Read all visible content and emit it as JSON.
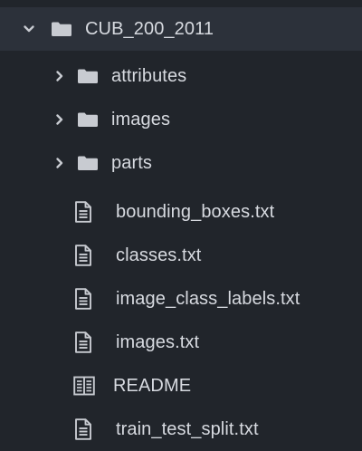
{
  "file_tree": {
    "root": {
      "label": "CUB_200_2011",
      "expanded": true,
      "icon": "folder-icon"
    },
    "folders": [
      {
        "label": "attributes",
        "expanded": false,
        "icon": "folder-icon"
      },
      {
        "label": "images",
        "expanded": false,
        "icon": "folder-icon"
      },
      {
        "label": "parts",
        "expanded": false,
        "icon": "folder-icon"
      }
    ],
    "files": [
      {
        "label": "bounding_boxes.txt",
        "icon": "text-file-icon"
      },
      {
        "label": "classes.txt",
        "icon": "text-file-icon"
      },
      {
        "label": "image_class_labels.txt",
        "icon": "text-file-icon"
      },
      {
        "label": "images.txt",
        "icon": "text-file-icon"
      },
      {
        "label": "README",
        "icon": "book-file-icon"
      },
      {
        "label": "train_test_split.txt",
        "icon": "text-file-icon"
      }
    ],
    "colors": {
      "background": "#21252b",
      "root_highlight": "#2c313a",
      "text": "#d7dae0",
      "icon": "#c8cbd1"
    }
  }
}
